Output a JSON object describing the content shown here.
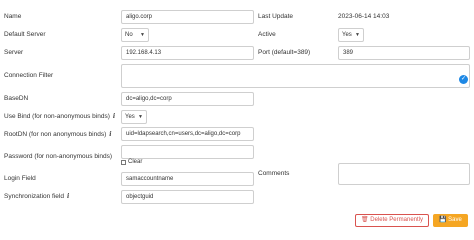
{
  "fields": {
    "name": {
      "label": "Name",
      "value": "aligo.corp"
    },
    "last_update": {
      "label": "Last Update",
      "value": "2023-06-14 14:03"
    },
    "default_server": {
      "label": "Default Server",
      "value": "No"
    },
    "active": {
      "label": "Active",
      "value": "Yes"
    },
    "server": {
      "label": "Server",
      "value": "192.168.4.13"
    },
    "port": {
      "label": "Port (default=389)",
      "value": "389"
    },
    "connection_filter": {
      "label": "Connection Filter",
      "value": ""
    },
    "basedn": {
      "label": "BaseDN",
      "value": "dc=aligo,dc=corp"
    },
    "use_bind": {
      "label": "Use Bind (for non-anonymous binds)",
      "value": "Yes"
    },
    "rootdn": {
      "label": "RootDN (for non anonymous binds)",
      "value": "uid=ldapsearch,cn=users,dc=aligo,dc=corp"
    },
    "password": {
      "label": "Password (for non-anonymous binds)",
      "value": ""
    },
    "clear_label": "Clear",
    "comments": {
      "label": "Comments",
      "value": ""
    },
    "login_field": {
      "label": "Login Field",
      "value": "samaccountname"
    },
    "sync_field": {
      "label": "Synchronization field",
      "value": "objectguid"
    }
  },
  "buttons": {
    "delete": "Delete Permanently",
    "save": "Save"
  },
  "colors": {
    "accent": "#f5a623",
    "danger": "#d9534f",
    "validation": "#1e88e5"
  },
  "icons": [
    "info-icon",
    "chevron-down-icon",
    "trash-icon",
    "save-icon",
    "check-icon"
  ]
}
